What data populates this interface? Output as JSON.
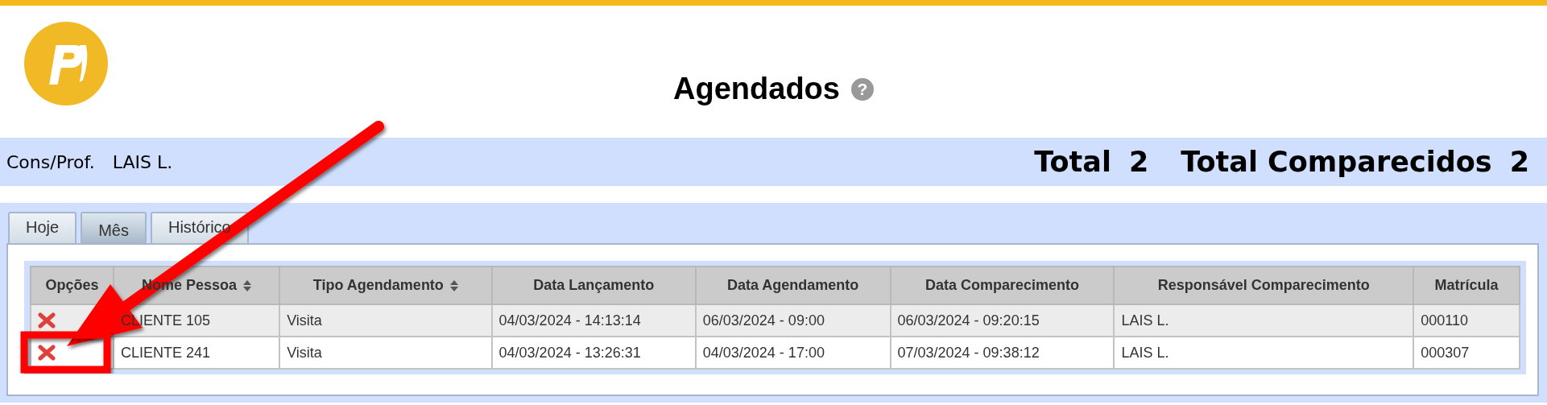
{
  "header": {
    "title": "Agendados",
    "help": "?"
  },
  "info_bar": {
    "label": "Cons/Prof.",
    "value": "LAIS L.",
    "totals": [
      {
        "label": "Total",
        "value": "2"
      },
      {
        "label": "Total Comparecidos",
        "value": "2"
      }
    ]
  },
  "tabs": [
    {
      "label": "Hoje",
      "selected": false
    },
    {
      "label": "Mês",
      "selected": true
    },
    {
      "label": "Histórico",
      "selected": false
    }
  ],
  "table": {
    "columns": [
      {
        "label": "Opções",
        "sortable": false
      },
      {
        "label": "Nome Pessoa",
        "sortable": true
      },
      {
        "label": "Tipo Agendamento",
        "sortable": true
      },
      {
        "label": "Data Lançamento",
        "sortable": false
      },
      {
        "label": "Data Agendamento",
        "sortable": false
      },
      {
        "label": "Data Comparecimento",
        "sortable": false
      },
      {
        "label": "Responsável Comparecimento",
        "sortable": false
      },
      {
        "label": "Matrícula",
        "sortable": false
      }
    ],
    "rows": [
      {
        "cells": [
          "",
          "CLIENTE 105",
          "Visita",
          "04/03/2024 - 14:13:14",
          "06/03/2024 - 09:00",
          "06/03/2024 - 09:20:15",
          "LAIS L.",
          "000110"
        ]
      },
      {
        "cells": [
          "",
          "CLIENTE 241",
          "Visita",
          "04/03/2024 - 13:26:31",
          "04/03/2024 - 17:00",
          "07/03/2024 - 09:38:12",
          "LAIS L.",
          "000307"
        ]
      }
    ]
  }
}
